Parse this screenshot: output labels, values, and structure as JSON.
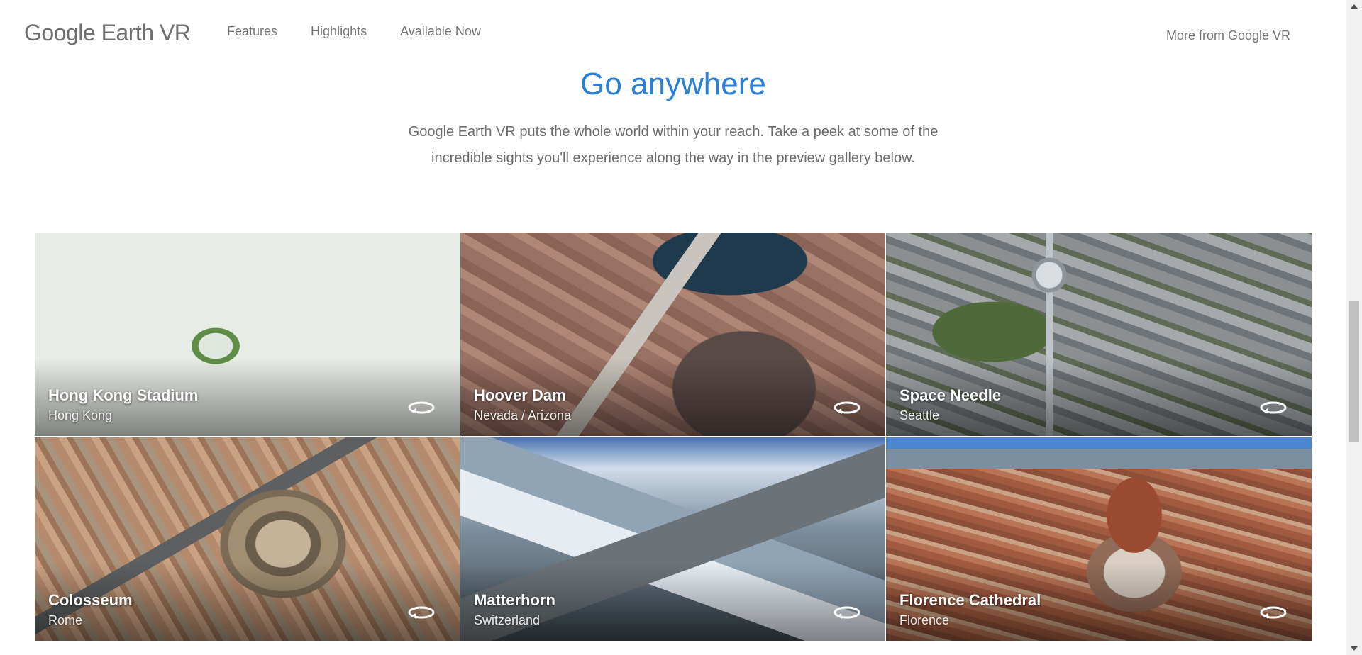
{
  "header": {
    "logo": "Google Earth VR",
    "nav": [
      "Features",
      "Highlights",
      "Available Now"
    ],
    "more_link": "More from Google VR"
  },
  "hero": {
    "title": "Go anywhere",
    "subtitle_line1": "Google Earth VR puts the whole world within your reach. Take a peek at some of the",
    "subtitle_line2": "incredible sights you'll experience along the way in the preview gallery below."
  },
  "gallery": {
    "items": [
      {
        "name": "Hong Kong Stadium",
        "location": "Hong Kong",
        "icon": "rotate-360-icon"
      },
      {
        "name": "Hoover Dam",
        "location": "Nevada / Arizona",
        "icon": "rotate-360-icon"
      },
      {
        "name": "Space Needle",
        "location": "Seattle",
        "icon": "rotate-360-icon"
      },
      {
        "name": "Colosseum",
        "location": "Rome",
        "icon": "rotate-360-icon"
      },
      {
        "name": "Matterhorn",
        "location": "Switzerland",
        "icon": "rotate-360-icon"
      },
      {
        "name": "Florence Cathedral",
        "location": "Florence",
        "icon": "rotate-360-icon"
      }
    ]
  },
  "colors": {
    "title_blue": "#2a7fd6",
    "nav_gray": "#757575",
    "body_gray": "#6b6b6b"
  }
}
